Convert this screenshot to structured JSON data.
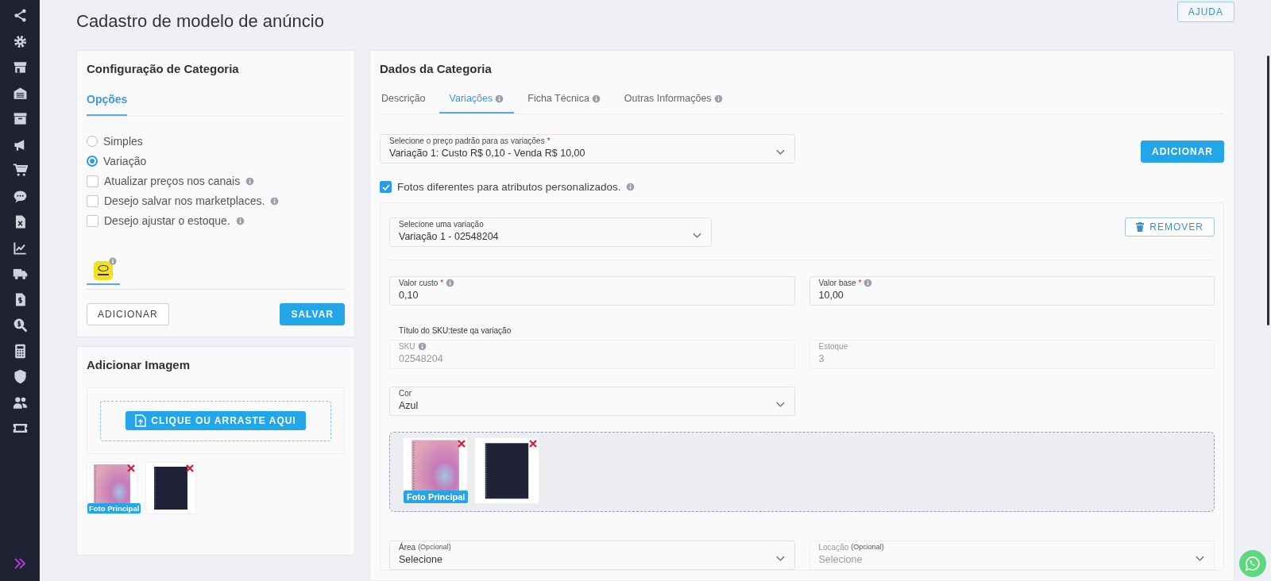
{
  "page": {
    "title": "Cadastro de modelo de anúncio",
    "help_button": "AJUDA"
  },
  "category_config": {
    "title": "Configuração de Categoria",
    "tabs": [
      {
        "label": "Opções",
        "selected": true
      }
    ],
    "options": [
      {
        "kind": "radio",
        "label": "Simples",
        "selected": false,
        "info": false
      },
      {
        "kind": "radio",
        "label": "Variação",
        "selected": true,
        "info": false
      },
      {
        "kind": "checkbox",
        "label": "Atualizar preços nos canais",
        "checked": false,
        "info": true
      },
      {
        "kind": "checkbox",
        "label": "Desejo salvar nos marketplaces.",
        "checked": false,
        "info": true
      },
      {
        "kind": "checkbox",
        "label": "Desejo ajustar o estoque.",
        "checked": false,
        "info": true
      }
    ],
    "channels": [
      {
        "selected": true
      }
    ],
    "buttons": [
      {
        "kind": "outline",
        "label": "ADICIONAR"
      },
      {
        "kind": "primary",
        "label": "SALVAR"
      }
    ]
  },
  "add_image": {
    "title": "Adicionar Imagem",
    "upload_button": "CLIQUE OU ARRASTE AQUI",
    "images": [
      {
        "kind": "pink",
        "badge": "Foto Principal"
      },
      {
        "kind": "dark"
      }
    ]
  },
  "category_data": {
    "title": "Dados da Categoria",
    "tabs": [
      {
        "label": "Descrição",
        "selected": false,
        "info": false
      },
      {
        "label": "Variações",
        "selected": true,
        "info": true
      },
      {
        "label": "Ficha Técnica",
        "selected": false,
        "info": true
      },
      {
        "label": "Outras Informações",
        "selected": false,
        "info": true
      }
    ],
    "default_price": {
      "label": "Selecione o preço padrão para as variações",
      "required_mark": "*",
      "value": "Variação 1: Custo R$ 0,10 - Venda R$ 10,00"
    },
    "add_button": "ADICIONAR",
    "custom_photos": {
      "label": "Fotos diferentes para atributos personalizados.",
      "checked": true
    },
    "variation": {
      "select": {
        "label": "Selecione uma variação",
        "value": "Variação 1 - 02548204"
      },
      "remove_button": "REMOVER",
      "price_fields": [
        {
          "kind": "input",
          "label": "Valor custo",
          "required_mark": "*",
          "info": true,
          "disabled": false,
          "value": "0,10"
        },
        {
          "kind": "input",
          "label": "Valor base",
          "required_mark": "*",
          "info": true,
          "disabled": false,
          "value": "10,00"
        }
      ],
      "sku_title": "Título do SKU:teste qa variação",
      "sku_fields": [
        {
          "kind": "input",
          "label": "SKU",
          "info": true,
          "disabled": true,
          "value": "02548204"
        },
        {
          "kind": "input",
          "label": "Estoque",
          "info": false,
          "disabled": true,
          "value": "3"
        }
      ],
      "attribute_fields": [
        {
          "kind": "select",
          "label": "Cor",
          "info": false,
          "disabled": false,
          "value": "Azul"
        }
      ],
      "images": [
        {
          "kind": "pink",
          "badge": "Foto Principal"
        },
        {
          "kind": "dark"
        }
      ],
      "location_fields": [
        {
          "kind": "select",
          "label": "Área",
          "note": "(Opcional)",
          "info": false,
          "disabled": false,
          "value": "Selecione"
        },
        {
          "kind": "select",
          "label": "Locação",
          "note": "(Opcional)",
          "info": false,
          "disabled": true,
          "value": "Selecione"
        }
      ]
    }
  }
}
